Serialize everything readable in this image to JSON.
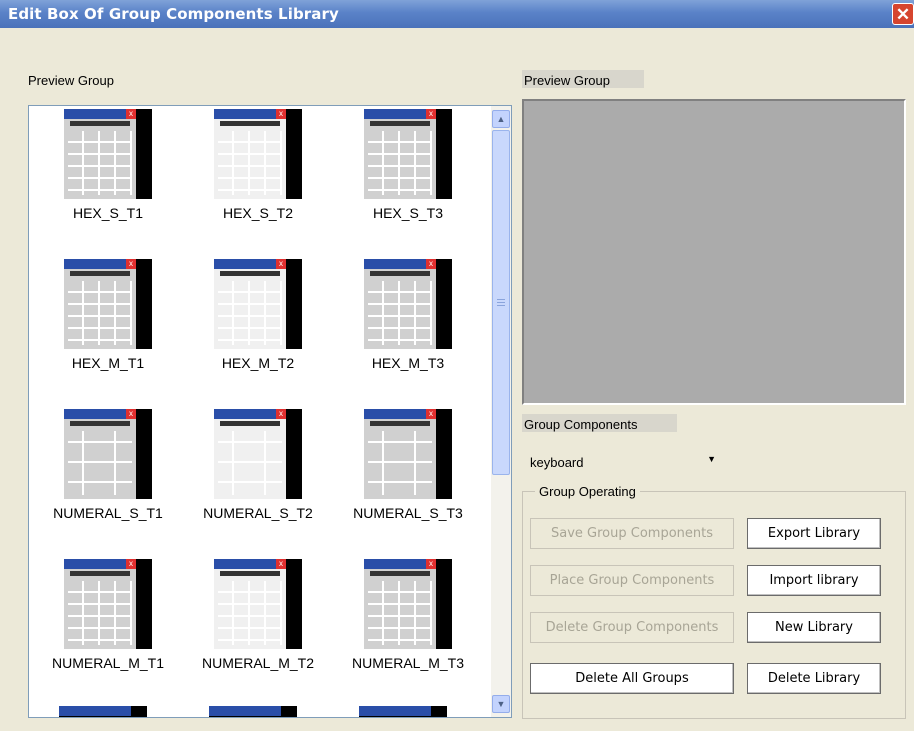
{
  "window": {
    "title": "Edit Box Of Group Components Library",
    "close_glyph": "✕"
  },
  "left_label": "Preview Group",
  "right_label": "Preview Group",
  "components_label": "Group Components",
  "combo": {
    "value": "keyboard"
  },
  "group_operating": {
    "legend": "Group Operating",
    "save": "Save Group Components",
    "place": "Place Group Components",
    "delete_group": "Delete Group Components",
    "delete_all": "Delete All Groups",
    "export": "Export Library",
    "import": "Import library",
    "new": "New Library",
    "delete_library": "Delete Library"
  },
  "items": [
    {
      "label": "HEX_S_T1"
    },
    {
      "label": "HEX_S_T2"
    },
    {
      "label": "HEX_S_T3"
    },
    {
      "label": "HEX_M_T1"
    },
    {
      "label": "HEX_M_T2"
    },
    {
      "label": "HEX_M_T3"
    },
    {
      "label": "NUMERAL_S_T1"
    },
    {
      "label": "NUMERAL_S_T2"
    },
    {
      "label": "NUMERAL_S_T3"
    },
    {
      "label": "NUMERAL_M_T1"
    },
    {
      "label": "NUMERAL_M_T2"
    },
    {
      "label": "NUMERAL_M_T3"
    }
  ],
  "icons": {
    "close": "close-icon",
    "dropdown": "chevron-down-icon",
    "scroll_up": "scroll-up-icon",
    "scroll_down": "scroll-down-icon"
  }
}
